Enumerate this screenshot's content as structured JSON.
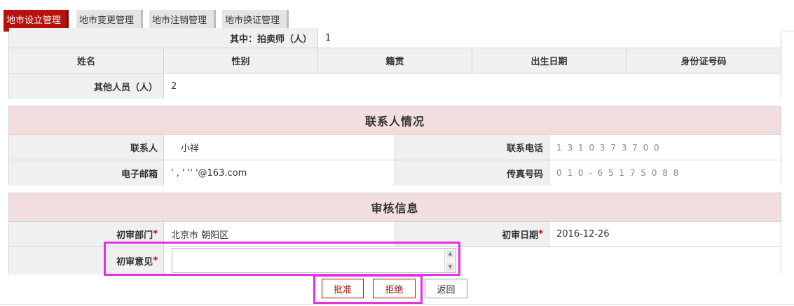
{
  "tabs": [
    {
      "label": "地市设立管理",
      "active": true
    },
    {
      "label": "地市变更管理",
      "active": false
    },
    {
      "label": "地市注销管理",
      "active": false
    },
    {
      "label": "地市换证管理",
      "active": false
    }
  ],
  "personnel": {
    "auctioneer_label": "其中：拍卖师（人）",
    "auctioneer_value": "1",
    "columns": [
      "姓名",
      "性别",
      "籍贯",
      "出生日期",
      "身份证号码"
    ],
    "others_label": "其他人员（人）",
    "others_value": "2"
  },
  "contact": {
    "title": "联系人情况",
    "name_label": "联系人",
    "name_value": "小祥",
    "phone_label": "联系电话",
    "phone_value": "1 3 1 0 3 7 3 7 0 0",
    "email_label": "电子邮箱",
    "email_value": "'    ,     '    '' '@163.com",
    "fax_label": "传真号码",
    "fax_value": "0 1 0 - 6 5 1 7 5 0 8 8"
  },
  "review": {
    "title": "审核信息",
    "dept_label": "初审部门",
    "dept_value": "北京市 朝阳区",
    "date_label": "初审日期",
    "date_value": "2016-12-26",
    "opinion_label": "初审意见",
    "opinion_value": "",
    "required_mark": "*"
  },
  "actions": {
    "approve_label": "批准",
    "reject_label": "拒绝",
    "back_label": "返回"
  },
  "colors": {
    "accent": "#b5120b",
    "highlight": "#e233e2",
    "section_bg": "#f2dede"
  }
}
